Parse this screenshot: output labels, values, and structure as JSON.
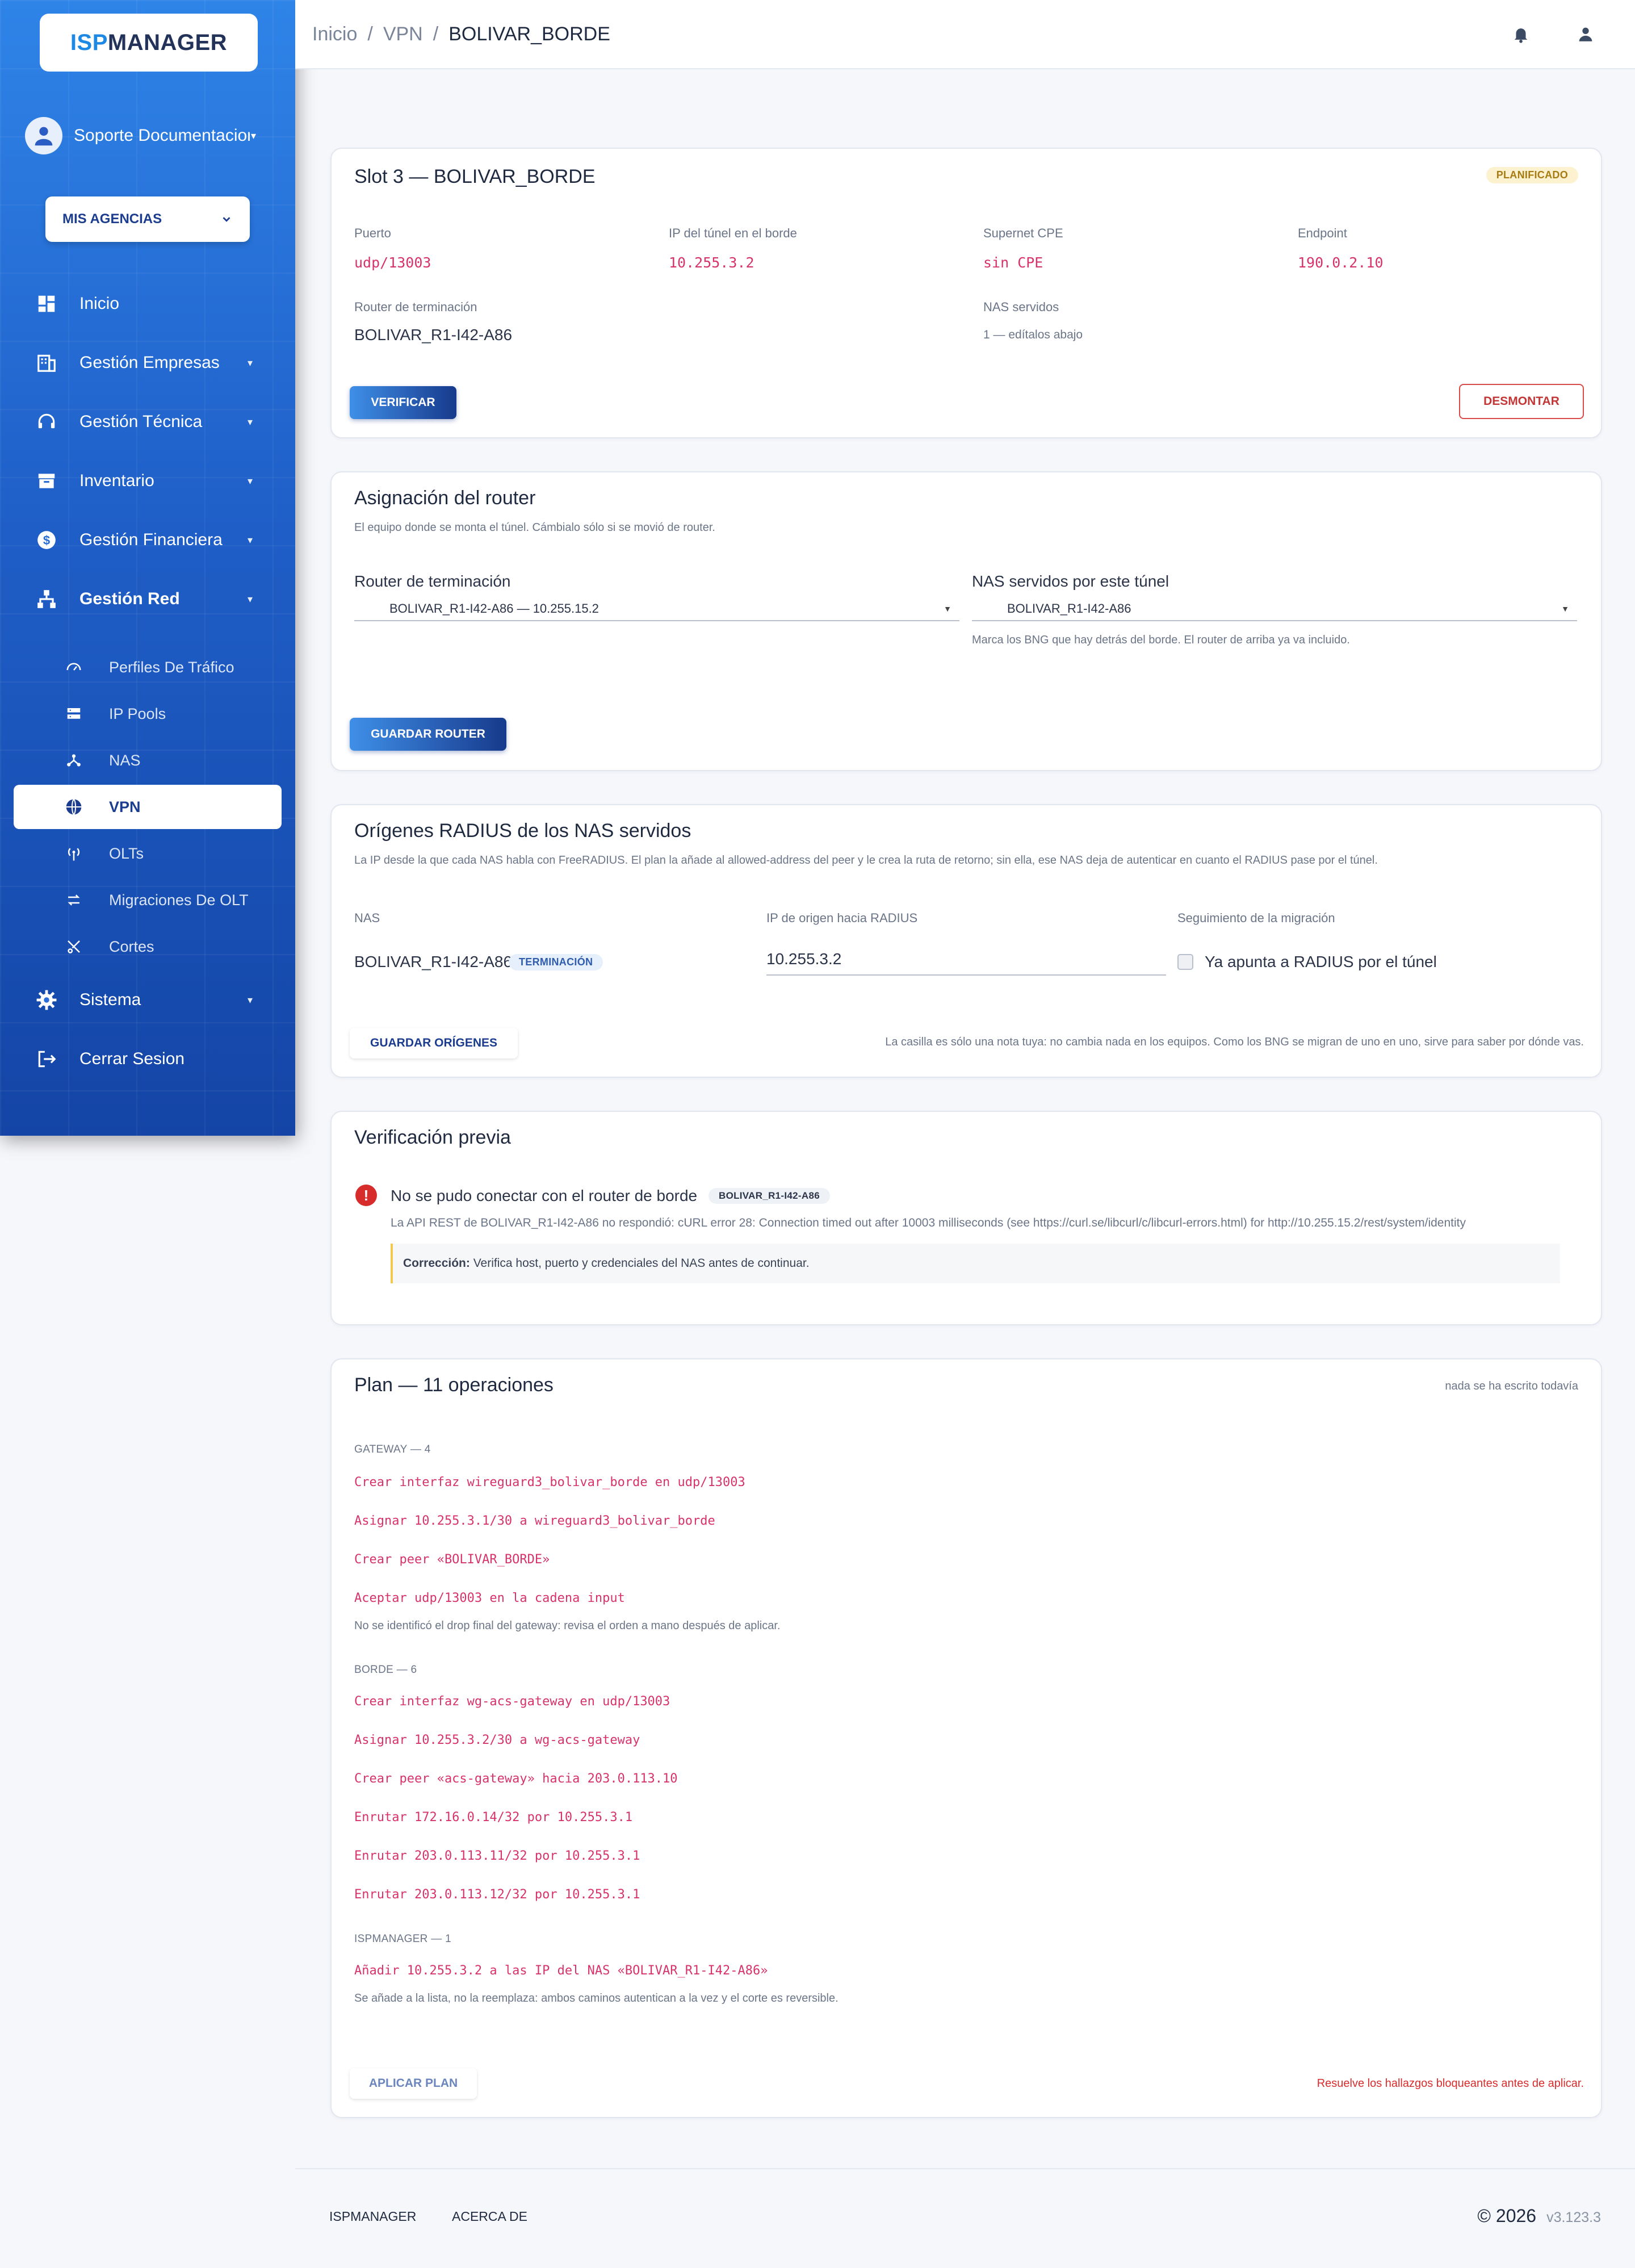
{
  "sidebar": {
    "logo": {
      "part1": "ISP",
      "part2": "MANAGER"
    },
    "user_name": "Soporte Documentacion",
    "agency_label": "MIS AGENCIAS",
    "nav": [
      {
        "label": "Inicio",
        "icon": "dashboard-icon"
      },
      {
        "label": "Gestión Empresas",
        "icon": "building-icon"
      },
      {
        "label": "Gestión Técnica",
        "icon": "headset-icon"
      },
      {
        "label": "Inventario",
        "icon": "archive-icon"
      },
      {
        "label": "Gestión Financiera",
        "icon": "dollar-icon"
      },
      {
        "label": "Gestión Red",
        "icon": "network-icon"
      }
    ],
    "sub": [
      {
        "label": "Perfiles De Tráfico",
        "icon": "speedometer-icon"
      },
      {
        "label": "IP Pools",
        "icon": "server-icon"
      },
      {
        "label": "NAS",
        "icon": "hub-icon"
      },
      {
        "label": "VPN",
        "icon": "vpn-globe-icon"
      },
      {
        "label": "OLTs",
        "icon": "antenna-icon"
      },
      {
        "label": "Migraciones De OLT",
        "icon": "swap-icon"
      },
      {
        "label": "Cortes",
        "icon": "cut-icon"
      }
    ],
    "system": "Sistema",
    "logout": "Cerrar Sesion"
  },
  "breadcrumb": {
    "items": [
      "Inicio",
      "VPN"
    ],
    "current": "BOLIVAR_BORDE",
    "separator": "/"
  },
  "slot": {
    "title": "Slot 3 — BOLIVAR_BORDE",
    "status": "PLANIFICADO",
    "puerto_label": "Puerto",
    "puerto": "udp/13003",
    "ip_label": "IP del túnel en el borde",
    "ip": "10.255.3.2",
    "supernet_label": "Supernet CPE",
    "supernet": "sin CPE",
    "endpoint_label": "Endpoint",
    "endpoint": "190.0.2.10",
    "router_label": "Router de terminación",
    "router": "BOLIVAR_R1-I42-A86",
    "nas_label": "NAS servidos",
    "nas": "1 — edítalos abajo",
    "verify_btn": "VERIFICAR",
    "unmount_btn": "DESMONTAR"
  },
  "assign": {
    "title": "Asignación del router",
    "subtitle": "El equipo donde se monta el túnel. Cámbialo sólo si se movió de router.",
    "router_label": "Router de terminación",
    "router_value": "BOLIVAR_R1-I42-A86 — 10.255.15.2",
    "nas_label": "NAS servidos por este túnel",
    "nas_value": "BOLIVAR_R1-I42-A86",
    "nas_hint": "Marca los BNG que hay detrás del borde. El router de arriba ya va incluido.",
    "save_btn": "GUARDAR ROUTER"
  },
  "radius": {
    "title": "Orígenes RADIUS de los NAS servidos",
    "subtitle": "La IP desde la que cada NAS habla con FreeRADIUS. El plan la añade al allowed-address del peer y le crea la ruta de retorno; sin ella, ese NAS deja de autenticar en cuanto el RADIUS pase por el túnel.",
    "col_nas": "NAS",
    "col_ip": "IP de origen hacia RADIUS",
    "col_track": "Seguimiento de la migración",
    "row_nas": "BOLIVAR_R1-I42-A86",
    "row_badge": "TERMINACIÓN",
    "row_ip": "10.255.3.2",
    "row_check": "Ya apunta a RADIUS por el túnel",
    "save_btn": "GUARDAR ORÍGENES",
    "note": "La casilla es sólo una nota tuya: no cambia nada en los equipos. Como los BNG se migran de uno en uno, sirve para saber por dónde vas."
  },
  "verify": {
    "title": "Verificación previa",
    "error_title": "No se pudo conectar con el router de borde",
    "error_badge": "BOLIVAR_R1-I42-A86",
    "error_detail": "La API REST de BOLIVAR_R1-I42-A86 no respondió: cURL error 28: Connection timed out after 10003 milliseconds (see https://curl.se/libcurl/c/libcurl-errors.html) for http://10.255.15.2/rest/system/identity",
    "fix_label": "Corrección:",
    "fix_text": "Verifica host, puerto y credenciales del NAS antes de continuar."
  },
  "plan": {
    "title": "Plan — 11 operaciones",
    "status": "nada se ha escrito todavía",
    "gateway_title": "GATEWAY — 4",
    "gateway_ops": [
      "Crear interfaz wireguard3_bolivar_borde en udp/13003",
      "Asignar 10.255.3.1/30 a wireguard3_bolivar_borde",
      "Crear peer «BOLIVAR_BORDE»",
      "Aceptar udp/13003 en la cadena input"
    ],
    "gateway_note": "No se identificó el drop final del gateway: revisa el orden a mano después de aplicar.",
    "borde_title": "BORDE — 6",
    "borde_ops": [
      "Crear interfaz wg-acs-gateway en udp/13003",
      "Asignar 10.255.3.2/30 a wg-acs-gateway",
      "Crear peer «acs-gateway» hacia 203.0.113.10",
      "Enrutar 172.16.0.14/32 por 10.255.3.1",
      "Enrutar 203.0.113.11/32 por 10.255.3.1",
      "Enrutar 203.0.113.12/32 por 10.255.3.1"
    ],
    "isp_title": "ISPMANAGER — 1",
    "isp_ops": [
      "Añadir 10.255.3.2 a las IP del NAS «BOLIVAR_R1-I42-A86»"
    ],
    "isp_note": "Se añade a la lista, no la reemplaza: ambos caminos autentican a la vez y el corte es reversible.",
    "apply_btn": "APLICAR PLAN",
    "warning": "Resuelve los hallazgos bloqueantes antes de aplicar."
  },
  "footer": {
    "link1": "ISPMANAGER",
    "link2": "ACERCA DE",
    "copyright": "© 2026",
    "version": "v3.123.3"
  },
  "colors": {
    "accent": "#1c3d8f",
    "sidebar": "#2f84e8",
    "pink": "#d6336c",
    "danger": "#d62c2c"
  }
}
